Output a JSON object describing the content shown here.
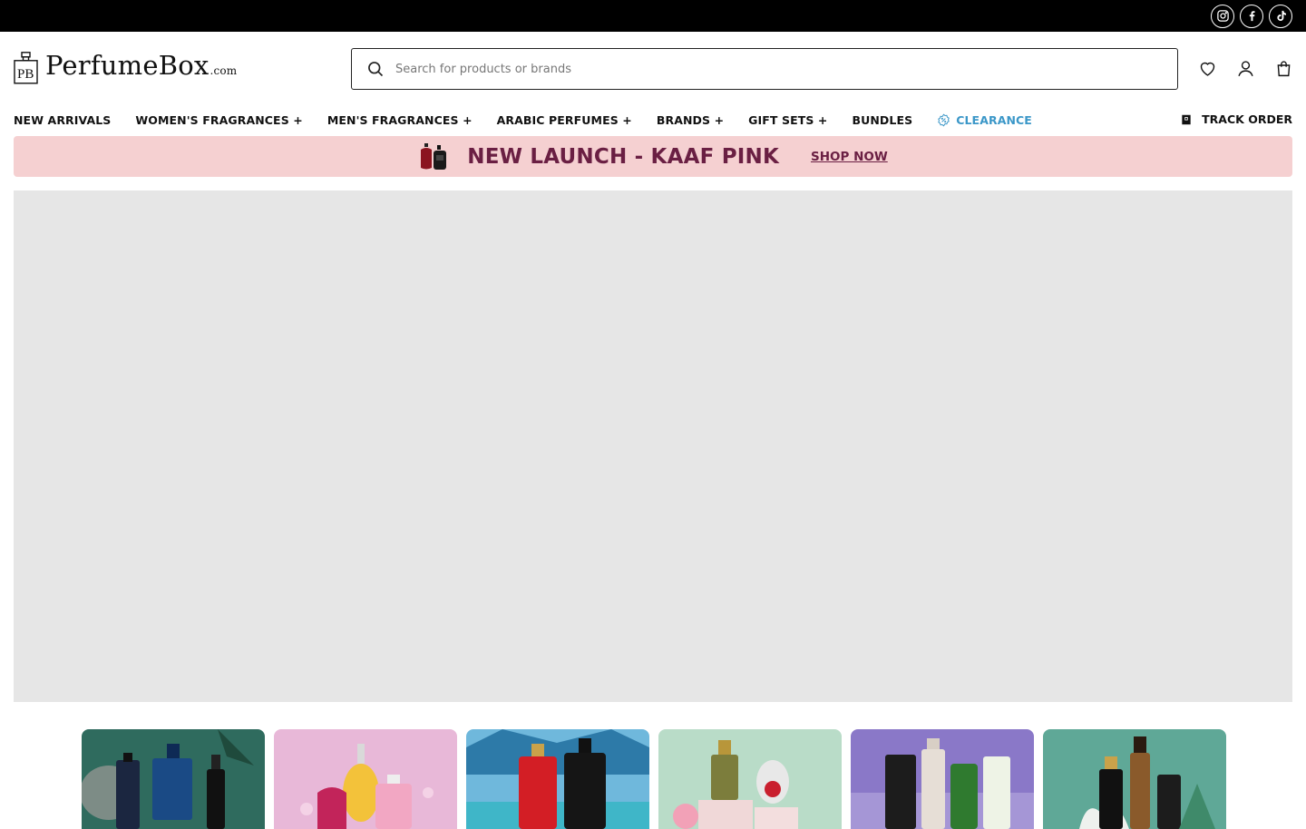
{
  "social": [
    {
      "name": "instagram-icon"
    },
    {
      "name": "facebook-icon"
    },
    {
      "name": "tiktok-icon"
    }
  ],
  "header": {
    "logo_text": "PerfumeBox",
    "logo_suffix": ".com",
    "search_placeholder": "Search for products or brands"
  },
  "nav": {
    "items": [
      "NEW ARRIVALS",
      "WOMEN'S FRAGRANCES +",
      "MEN'S FRAGRANCES +",
      "ARABIC PERFUMES +",
      "BRANDS +",
      "GIFT SETS +",
      "BUNDLES",
      "CLEARANCE"
    ],
    "track_order": "TRACK ORDER"
  },
  "promo": {
    "title": "NEW LAUNCH - KAAF PINK",
    "link": "SHOP NOW"
  },
  "colors": {
    "topbar": "#000000",
    "promo_bg": "#f5d0d1",
    "promo_text": "#6a1f43",
    "clearance": "#3b97c8",
    "hero_placeholder": "#e6e6e6"
  },
  "category_tiles": [
    {
      "name": "men-fragrances-tile",
      "bg": "#2f6b5e"
    },
    {
      "name": "women-fragrances-tile",
      "bg": "#e8b8d8"
    },
    {
      "name": "arabic-perfumes-tile",
      "bg": "#6fb8dc"
    },
    {
      "name": "gift-sets-tile",
      "bg": "#b9dcc8"
    },
    {
      "name": "niche-tile",
      "bg": "#8a78c8"
    },
    {
      "name": "bundles-tile",
      "bg": "#5fa897"
    }
  ]
}
